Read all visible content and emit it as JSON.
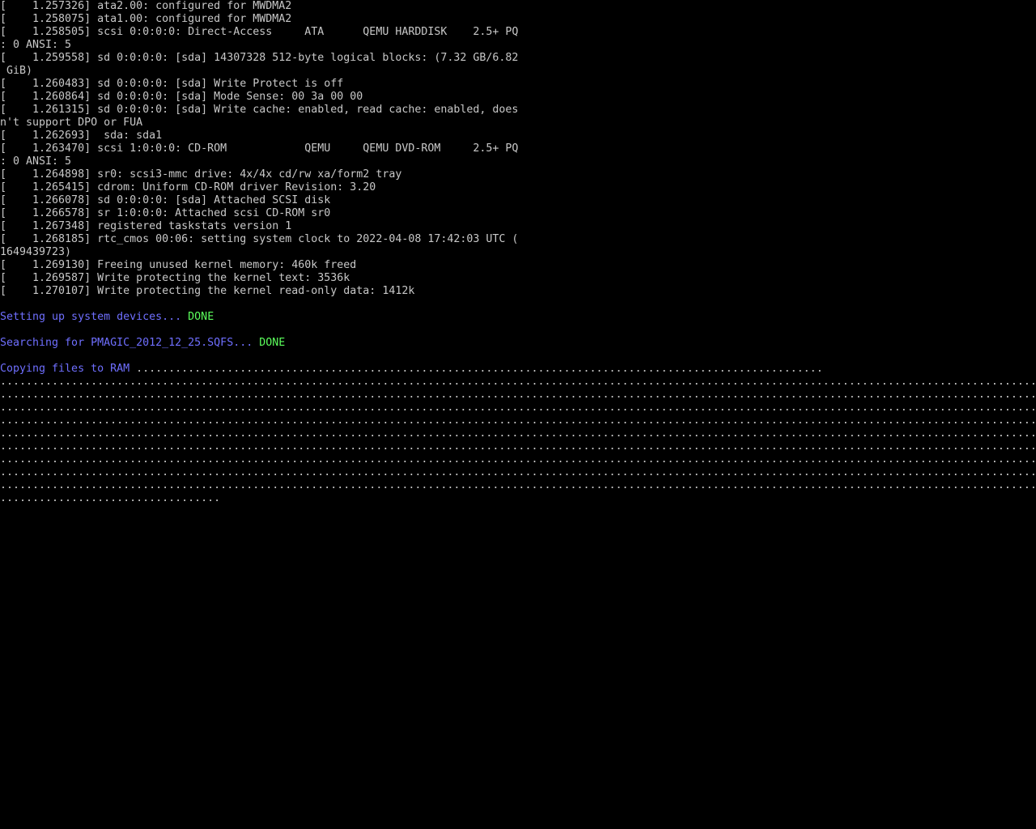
{
  "kernel_log": [
    "[    1.257326] ata2.00: configured for MWDMA2",
    "[    1.258075] ata1.00: configured for MWDMA2",
    "[    1.258505] scsi 0:0:0:0: Direct-Access     ATA      QEMU HARDDISK    2.5+ PQ",
    ": 0 ANSI: 5",
    "[    1.259558] sd 0:0:0:0: [sda] 14307328 512-byte logical blocks: (7.32 GB/6.82",
    " GiB)",
    "[    1.260483] sd 0:0:0:0: [sda] Write Protect is off",
    "[    1.260864] sd 0:0:0:0: [sda] Mode Sense: 00 3a 00 00",
    "[    1.261315] sd 0:0:0:0: [sda] Write cache: enabled, read cache: enabled, does",
    "n't support DPO or FUA",
    "[    1.262693]  sda: sda1",
    "[    1.263470] scsi 1:0:0:0: CD-ROM            QEMU     QEMU DVD-ROM     2.5+ PQ",
    ": 0 ANSI: 5",
    "[    1.264898] sr0: scsi3-mmc drive: 4x/4x cd/rw xa/form2 tray",
    "[    1.265415] cdrom: Uniform CD-ROM driver Revision: 3.20",
    "[    1.266078] sd 0:0:0:0: [sda] Attached SCSI disk",
    "[    1.266578] sr 1:0:0:0: Attached scsi CD-ROM sr0",
    "[    1.267348] registered taskstats version 1",
    "[    1.268185] rtc_cmos 00:06: setting system clock to 2022-04-08 17:42:03 UTC (",
    "1649439723)",
    "[    1.269130] Freeing unused kernel memory: 460k freed",
    "[    1.269587] Write protecting the kernel text: 3536k",
    "[    1.270107] Write protecting the kernel read-only data: 1412k"
  ],
  "status": {
    "setup_label": "Setting up system devices... ",
    "setup_result": "DONE",
    "search_label": "Searching for PMAGIC_2012_12_25.SQFS... ",
    "search_result": "DONE",
    "copy_label": "Copying files to RAM ",
    "copy_dots_first": "..........................................................................................................",
    "copy_dots_full": "................................................................................................................................................................",
    "copy_dots_last": ".................................."
  },
  "colors": {
    "background": "#000000",
    "text": "#c8c8c8",
    "status_label": "#6f6fff",
    "status_ok": "#5cff5c"
  }
}
